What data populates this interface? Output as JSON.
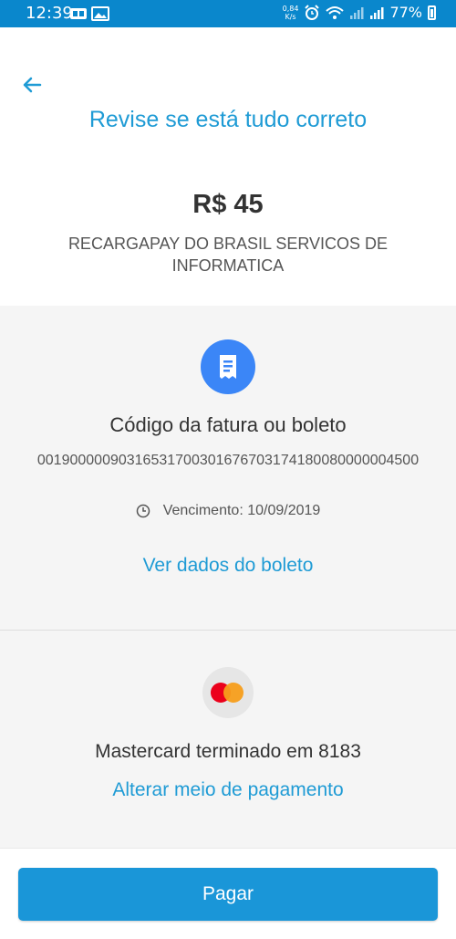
{
  "status_bar": {
    "time": "12:39",
    "net_speed_value": "0,84",
    "net_speed_unit": "K/s",
    "battery": "77%"
  },
  "header": {
    "title": "Revise se está tudo correto",
    "amount": "R$ 45",
    "merchant": "RECARGAPAY DO BRASIL SERVICOS DE INFORMATICA"
  },
  "bill": {
    "icon": "receipt-icon",
    "title": "Código da fatura ou boleto",
    "code": "00190000090316531700301676703174180080000004500",
    "due": "Vencimento: 10/09/2019",
    "details_link": "Ver dados do boleto"
  },
  "payment": {
    "icon": "mastercard-icon",
    "card": "Mastercard terminado em 8183",
    "change_link": "Alterar meio de pagamento"
  },
  "footer": {
    "pay_label": "Pagar"
  },
  "colors": {
    "status_bar": "#0a87cc",
    "accent": "#1f9bd5",
    "button": "#1a96d8",
    "icon_circle": "#3b86f7"
  }
}
